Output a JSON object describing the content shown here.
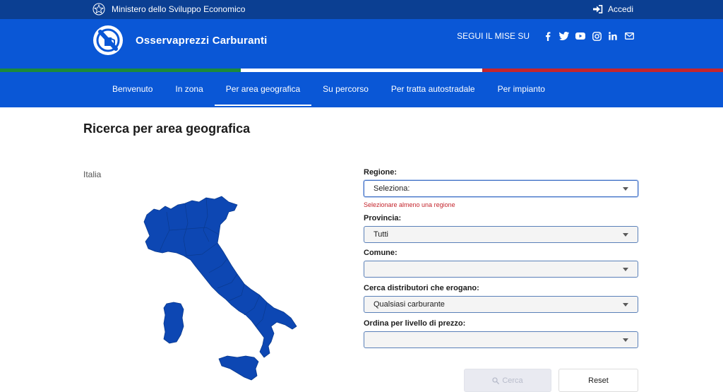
{
  "topbar": {
    "ministry": "Ministero dello Sviluppo Economico",
    "login": "Accedi"
  },
  "header": {
    "app_title": "Osservaprezzi Carburanti",
    "follow_label": "SEGUI IL MISE SU",
    "social_icons": [
      "facebook-icon",
      "twitter-icon",
      "youtube-icon",
      "instagram-icon",
      "linkedin-icon",
      "mail-icon"
    ]
  },
  "nav": {
    "items": [
      {
        "label": "Benvenuto"
      },
      {
        "label": "In zona"
      },
      {
        "label": "Per area geografica",
        "active": true
      },
      {
        "label": "Su percorso"
      },
      {
        "label": "Per tratta autostradale"
      },
      {
        "label": "Per impianto"
      }
    ]
  },
  "main": {
    "title": "Ricerca per area geografica",
    "map_caption": "Italia"
  },
  "form": {
    "regione": {
      "label": "Regione:",
      "value": "Seleziona:",
      "error": "Selezionare almeno una regione"
    },
    "provincia": {
      "label": "Provincia:",
      "value": "Tutti"
    },
    "comune": {
      "label": "Comune:",
      "value": ""
    },
    "carburante": {
      "label": "Cerca distributori che erogano:",
      "value": "Qualsiasi carburante"
    },
    "ordina": {
      "label": "Ordina per livello di prezzo:",
      "value": ""
    },
    "search_label": "Cerca",
    "reset_label": "Reset"
  },
  "colors": {
    "brand_blue": "#0a57d6",
    "topbar_blue": "#0b3f92",
    "map_fill": "#0d47b3",
    "error_red": "#c4252d"
  }
}
